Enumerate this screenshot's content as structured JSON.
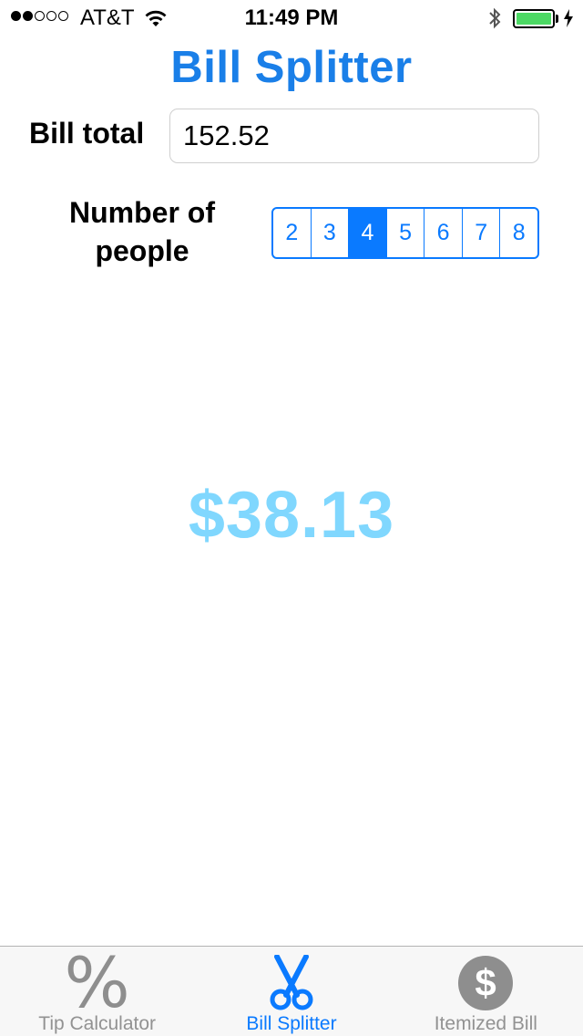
{
  "status_bar": {
    "signal_filled": 2,
    "signal_total": 5,
    "carrier": "AT&T",
    "time": "11:49 PM",
    "battery_level": 1.0
  },
  "title": "Bill Splitter",
  "bill": {
    "label": "Bill total",
    "value": "152.52"
  },
  "people": {
    "label": "Number of people",
    "options": [
      "2",
      "3",
      "4",
      "5",
      "6",
      "7",
      "8"
    ],
    "selected": "4"
  },
  "result": "$38.13",
  "tabs": [
    {
      "label": "Tip Calculator",
      "icon": "percent-icon",
      "active": false
    },
    {
      "label": "Bill Splitter",
      "icon": "scissors-icon",
      "active": true
    },
    {
      "label": "Itemized Bill",
      "icon": "dollar-circle-icon",
      "active": false
    }
  ],
  "colors": {
    "accent": "#0a7aff",
    "title": "#1a7fe8",
    "result": "#80d7fe",
    "battery": "#4cd964",
    "tab_inactive": "#8e8e8e"
  }
}
